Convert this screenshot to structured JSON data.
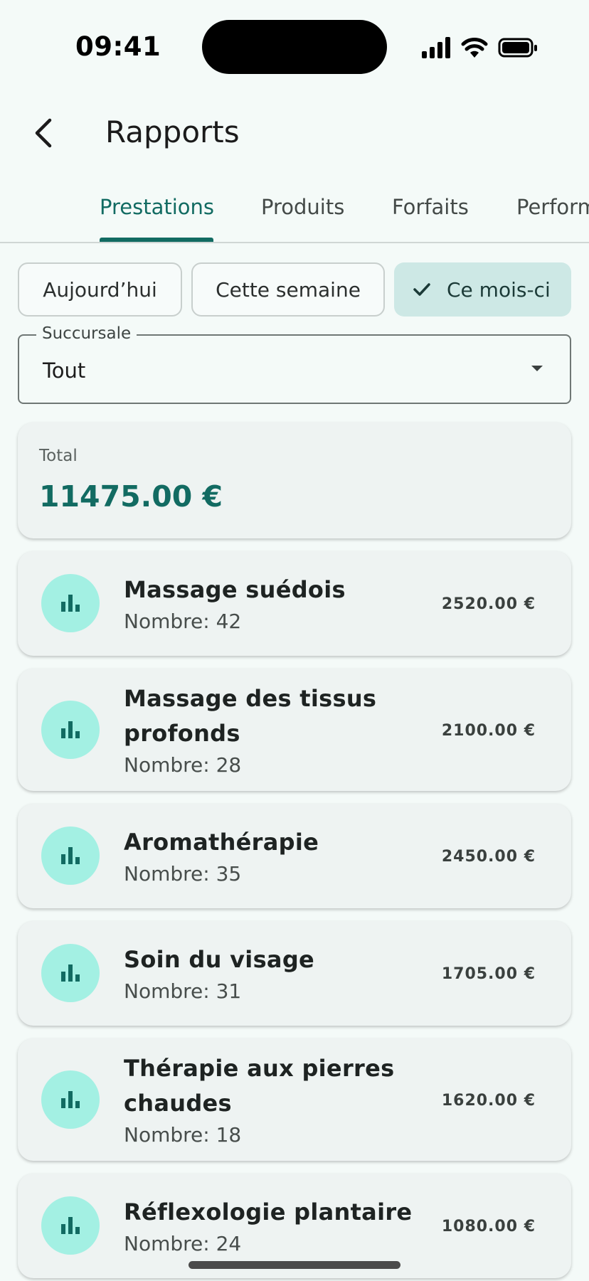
{
  "status_bar": {
    "time": "09:41"
  },
  "app_bar": {
    "title": "Rapports"
  },
  "tabs": [
    {
      "label": "Prestations",
      "active": true
    },
    {
      "label": "Produits",
      "active": false
    },
    {
      "label": "Forfaits",
      "active": false
    },
    {
      "label": "Performance",
      "active": false
    }
  ],
  "filters": {
    "chips": [
      {
        "label": "Aujourd’hui",
        "selected": false
      },
      {
        "label": "Cette semaine",
        "selected": false
      },
      {
        "label": "Ce mois-ci",
        "selected": true
      }
    ]
  },
  "branch_select": {
    "label": "Succursale",
    "value": "Tout"
  },
  "total": {
    "label": "Total",
    "value": "11475.00 €"
  },
  "items": [
    {
      "name_lines": [
        "Massage suédois"
      ],
      "count": "Nombre: 42",
      "amount": "2520.00 €",
      "icon": "bar-chart-icon"
    },
    {
      "name_lines": [
        "Massage des tissus",
        "profonds"
      ],
      "count": "Nombre: 28",
      "amount": "2100.00 €",
      "icon": "bar-chart-icon"
    },
    {
      "name_lines": [
        "Aromathérapie"
      ],
      "count": "Nombre: 35",
      "amount": "2450.00 €",
      "icon": "bar-chart-icon"
    },
    {
      "name_lines": [
        "Soin du visage"
      ],
      "count": "Nombre: 31",
      "amount": "1705.00 €",
      "icon": "bar-chart-icon"
    },
    {
      "name_lines": [
        "Thérapie aux pierres",
        "chaudes"
      ],
      "count": "Nombre: 18",
      "amount": "1620.00 €",
      "icon": "bar-chart-icon"
    },
    {
      "name_lines": [
        "Réflexologie plantaire"
      ],
      "count": "Nombre: 24",
      "amount": "1080.00 €",
      "icon": "bar-chart-icon"
    }
  ],
  "colors": {
    "accent": "#126b62",
    "avatar_bg": "#a3f0e3",
    "chip_selected_bg": "#cde8e5",
    "background": "#f4faf8"
  }
}
